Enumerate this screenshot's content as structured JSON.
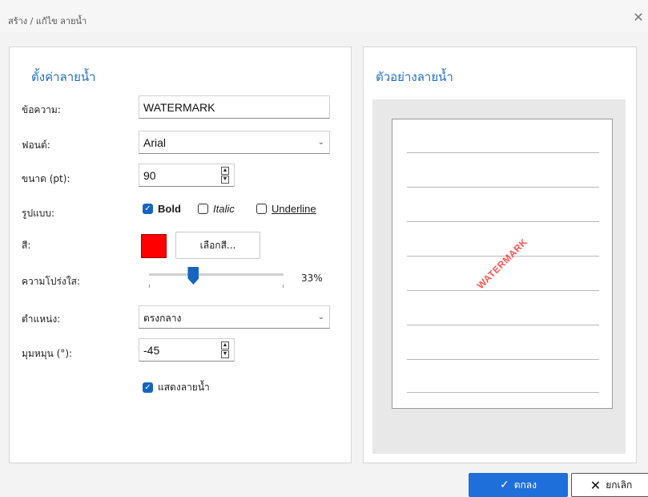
{
  "window": {
    "title": "สร้าง / แก้ไข ลายน้ำ",
    "close_glyph": "✕"
  },
  "settings": {
    "heading": "ตั้งค่าลายน้ำ",
    "text_label": "ข้อความ:",
    "text_value": "WATERMARK",
    "font_label": "ฟอนต์:",
    "font_value": "Arial",
    "size_label": "ขนาด (pt):",
    "size_value": "90",
    "style_label": "รูปแบบ:",
    "bold_label": "Bold",
    "bold_checked": true,
    "italic_label": "Italic",
    "italic_checked": false,
    "underline_label": "Underline",
    "underline_checked": false,
    "color_label": "สี:",
    "color_value": "#ff0000",
    "choose_color_button": "เลือกสี...",
    "transparency_label": "ความโปร่งใส:",
    "transparency_value": "33%",
    "transparency_fraction": 0.33,
    "position_label": "ตำแหน่ง:",
    "position_value": "ตรงกลาง",
    "rotation_label": "มุมหมุน (°):",
    "rotation_value": "-45",
    "show_watermark_label": "แสดงลายน้ำ",
    "show_watermark_checked": true
  },
  "preview": {
    "heading": "ตัวอย่างลายน้ำ",
    "watermark_text": "WATERMARK"
  },
  "footer": {
    "ok_label": "ตกลง",
    "cancel_label": "ยกเลิก"
  },
  "colors": {
    "accent": "#1565c0",
    "heading": "#1f6fc0",
    "watermark": "#ff0000"
  },
  "icons": {
    "check": "check-icon",
    "cancel": "x-icon",
    "combo": "chevron-down-icon",
    "close": "close-icon"
  }
}
